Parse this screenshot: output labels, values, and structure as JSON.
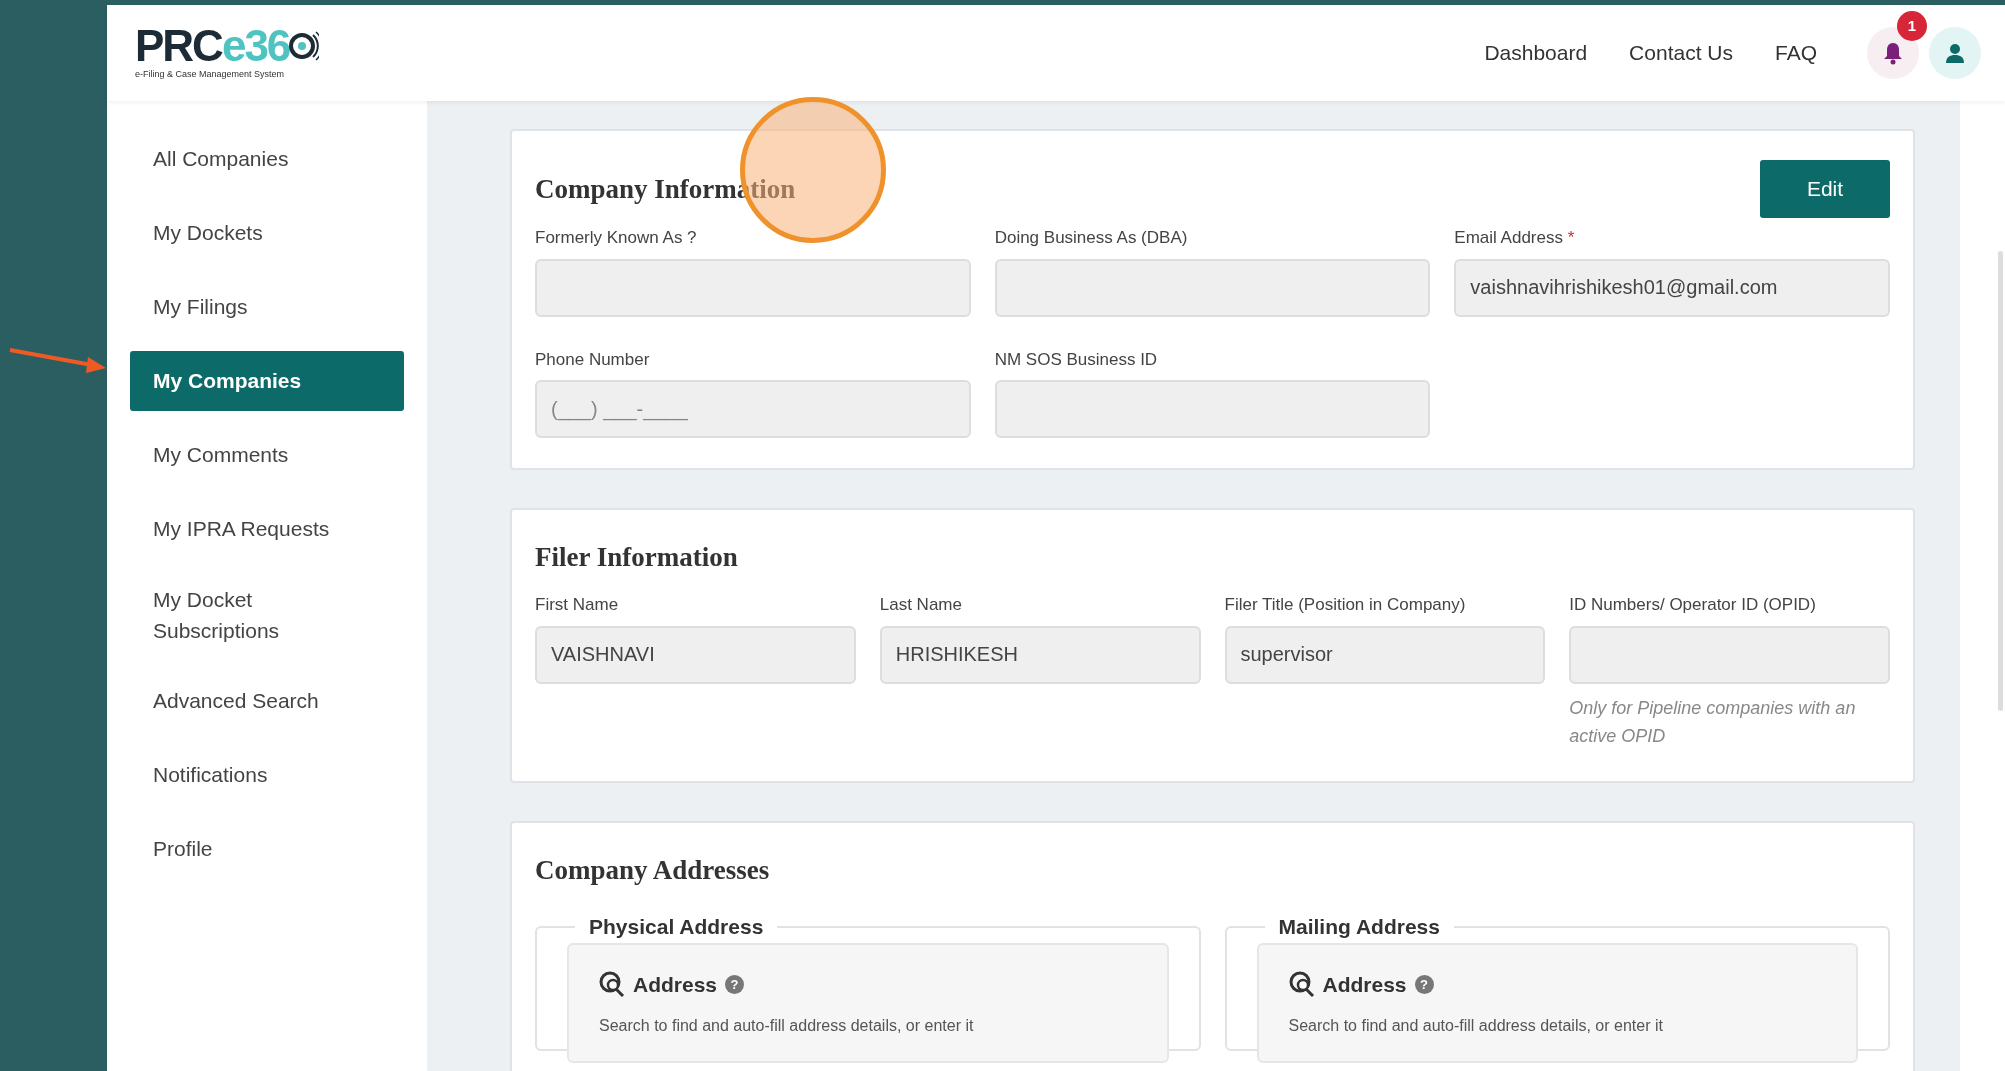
{
  "logo": {
    "wordmark_dark": "PRC",
    "wordmark_accent": "e36",
    "tagline": "e-Filing & Case Management System"
  },
  "required_mark": "*",
  "nav": {
    "links": [
      "Dashboard",
      "Contact Us",
      "FAQ"
    ],
    "notification_count": "1"
  },
  "sidebar": {
    "items": [
      {
        "label": "All Companies",
        "selected": false
      },
      {
        "label": "My Dockets",
        "selected": false
      },
      {
        "label": "My Filings",
        "selected": false
      },
      {
        "label": "My Companies",
        "selected": true
      },
      {
        "label": "My Comments",
        "selected": false
      },
      {
        "label": "My IPRA Requests",
        "selected": false
      },
      {
        "label": "My Docket Subscriptions",
        "selected": false
      },
      {
        "label": "Advanced Search",
        "selected": false
      },
      {
        "label": "Notifications",
        "selected": false
      },
      {
        "label": "Profile",
        "selected": false
      }
    ]
  },
  "sections": [
    {
      "kind": "fields3",
      "title": "Company Information",
      "button": "Edit",
      "fields": [
        {
          "label": "Formerly Known As ?",
          "required": false
        },
        {
          "label": "Doing Business As (DBA)",
          "required": false
        },
        {
          "label": "Email Address",
          "required": true,
          "value": "vaishnavihrishikesh01@gmail.com"
        },
        {
          "label": "Phone Number",
          "required": false,
          "placeholder": "(___) ___-____"
        },
        {
          "label": "NM SOS Business ID",
          "required": false
        }
      ]
    },
    {
      "kind": "fields4",
      "title": "Filer Information",
      "fields": [
        {
          "label": "First Name",
          "required": false,
          "value": "VAISHNAVI"
        },
        {
          "label": "Last Name",
          "required": false,
          "value": "HRISHIKESH"
        },
        {
          "label": "Filer Title (Position in Company)",
          "required": false,
          "value": "supervisor"
        },
        {
          "label": "ID Numbers/ Operator ID (OPID)",
          "required": false,
          "hint": "Only for Pipeline companies with an active OPID"
        }
      ]
    },
    {
      "kind": "addresses",
      "title": "Company Addresses",
      "groups": [
        {
          "legend": "Physical Address",
          "heading": "Address",
          "help": "?",
          "text": "Search to find and auto-fill address details, or enter it"
        },
        {
          "legend": "Mailing Address",
          "heading": "Address",
          "help": "?",
          "text": "Search to find and auto-fill address details, or enter it"
        }
      ]
    }
  ]
}
